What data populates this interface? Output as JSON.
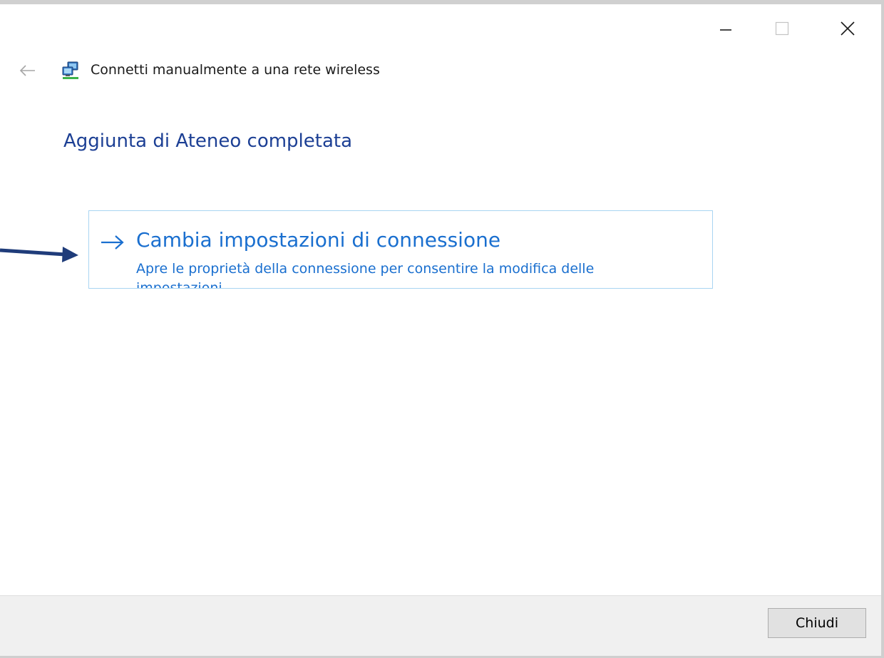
{
  "window": {
    "title": "Connetti manualmente a una rete wireless",
    "controls": [
      "minimize-icon",
      "maximize-icon",
      "close-icon"
    ]
  },
  "header": {
    "back_icon": "back-arrow-icon",
    "network_icon": "network-computer-icon"
  },
  "main": {
    "title": "Aggiunta di Ateneo completata",
    "command_link": {
      "icon": "arrow-right-icon",
      "title": "Cambia impostazioni di connessione",
      "description": "Apre le proprietà della connessione per consentire la modifica delle impostazioni"
    }
  },
  "footer": {
    "close_label": "Chiudi"
  },
  "colors": {
    "heading": "#1c3f94",
    "link": "#1a6fcf",
    "link_border": "#a9d5f2",
    "annotation_arrow": "#1f3c7a",
    "footer_bg": "#f0f0f0"
  }
}
